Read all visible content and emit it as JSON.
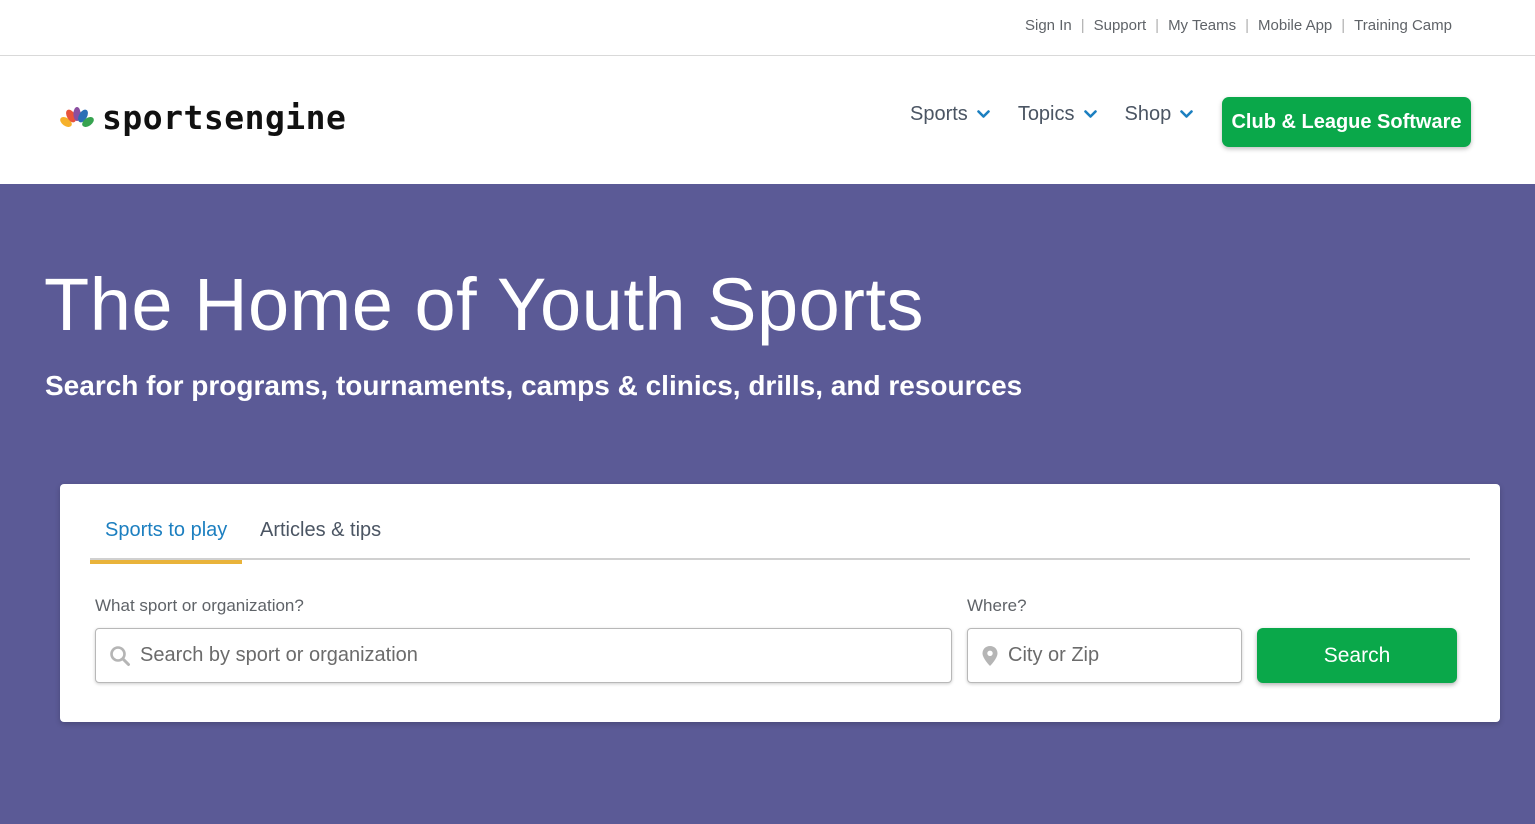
{
  "utility_nav": {
    "links": [
      "Sign In",
      "Support",
      "My Teams",
      "Mobile App",
      "Training Camp"
    ]
  },
  "header": {
    "logo_text": "sportsengine",
    "nav": [
      {
        "label": "Sports",
        "icon": "chevron-down-icon"
      },
      {
        "label": "Topics",
        "icon": "chevron-down-icon"
      },
      {
        "label": "Shop",
        "icon": "chevron-down-icon"
      }
    ],
    "cta_label": "Club & League Software"
  },
  "hero": {
    "title": "The Home of Youth Sports",
    "subtitle": "Search for programs, tournaments, camps & clinics, drills, and resources"
  },
  "search": {
    "tabs": [
      "Sports to play",
      "Articles & tips"
    ],
    "active_tab": "Sports to play",
    "sport_label": "What sport or organization?",
    "sport_placeholder": "Search by sport or organization",
    "sport_icon": "search-icon",
    "where_label": "Where?",
    "where_placeholder": "City or Zip",
    "where_icon": "map-pin-icon",
    "button_label": "Search"
  },
  "colors": {
    "hero_bg": "#5b5a96",
    "brand_green": "#0aa84a",
    "tab_active": "#1c7fc0",
    "tab_underline": "#e9b33a",
    "nav_chevron": "#1c7fc0"
  }
}
